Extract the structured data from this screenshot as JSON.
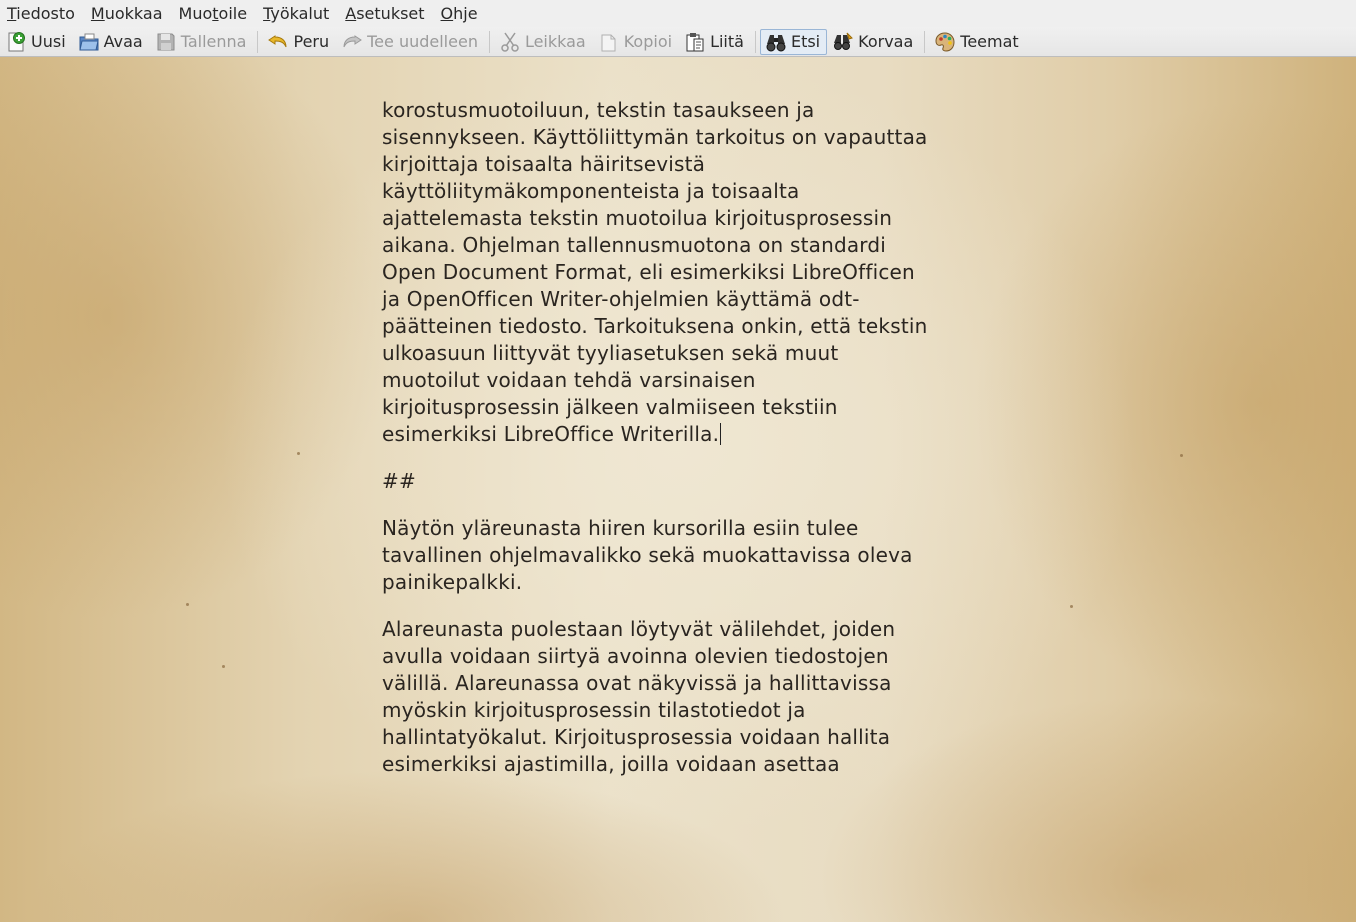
{
  "menu": [
    {
      "mnemonic": "T",
      "rest": "iedosto"
    },
    {
      "mnemonic": "M",
      "rest": "uokkaa"
    },
    {
      "pre": "Muo",
      "mnemonic": "t",
      "rest": "oile"
    },
    {
      "mnemonic": "T",
      "rest": "yökalut"
    },
    {
      "mnemonic": "A",
      "rest": "setukset"
    },
    {
      "mnemonic": "O",
      "rest": "hje"
    }
  ],
  "toolbar": {
    "new": "Uusi",
    "open": "Avaa",
    "save": "Tallenna",
    "undo": "Peru",
    "redo": "Tee uudelleen",
    "cut": "Leikkaa",
    "copy": "Kopioi",
    "paste": "Liitä",
    "find": "Etsi",
    "replace": "Korvaa",
    "themes": "Teemat"
  },
  "document": {
    "partial_top_line": "korostusmuotoiluun, tekstin tasaukseen ja",
    "paragraph1": [
      "korostusmuotoiluun, tekstin tasaukseen ja",
      "sisennykseen. Käyttöliittymän tarkoitus on vapauttaa",
      "kirjoittaja toisaalta häiritsevistä",
      "käyttöliitymäkomponenteista ja toisaalta",
      "ajattelemasta tekstin muotoilua kirjoitusprosessin",
      "aikana. Ohjelman tallennusmuotona on standardi",
      "Open Document Format, eli esimerkiksi LibreOfficen",
      "ja OpenOfficen Writer-ohjelmien käyttämä odt-",
      "päätteinen tiedosto. Tarkoituksena onkin, että tekstin",
      "ulkoasuun liittyvät tyyliasetuksen sekä muut",
      "muotoilut voidaan tehdä varsinaisen",
      "kirjoitusprosessin jälkeen valmiiseen tekstiin",
      "esimerkiksi LibreOffice Writerilla."
    ],
    "heading_marker": "##",
    "paragraph2": [
      "Näytön yläreunasta hiiren kursorilla esiin tulee",
      "tavallinen ohjelmavalikko sekä muokattavissa oleva",
      "painikepalkki."
    ],
    "paragraph3": [
      "Alareunasta puolestaan löytyvät välilehdet, joiden",
      "avulla voidaan siirtyä avoinna olevien tiedostojen",
      "välillä. Alareunassa ovat näkyvissä ja hallittavissa",
      "myöskin kirjoitusprosessin tilastotiedot ja",
      "hallintatyökalut. Kirjoitusprosessia voidaan hallita",
      "esimerkiksi ajastimilla, joilla voidaan asettaa"
    ]
  },
  "icons": {
    "new": "new-document-icon",
    "open": "open-folder-icon",
    "save": "save-disk-icon",
    "undo": "undo-icon",
    "redo": "redo-icon",
    "cut": "scissors-icon",
    "copy": "copy-icon",
    "paste": "paste-clipboard-icon",
    "find": "binoculars-icon",
    "replace": "binoculars-replace-icon",
    "themes": "palette-icon"
  },
  "colors": {
    "menubar_bg": "#efefef",
    "text": "#2a2520",
    "active_border": "#9ab6d6",
    "disabled_text": "#9a9a9a"
  }
}
